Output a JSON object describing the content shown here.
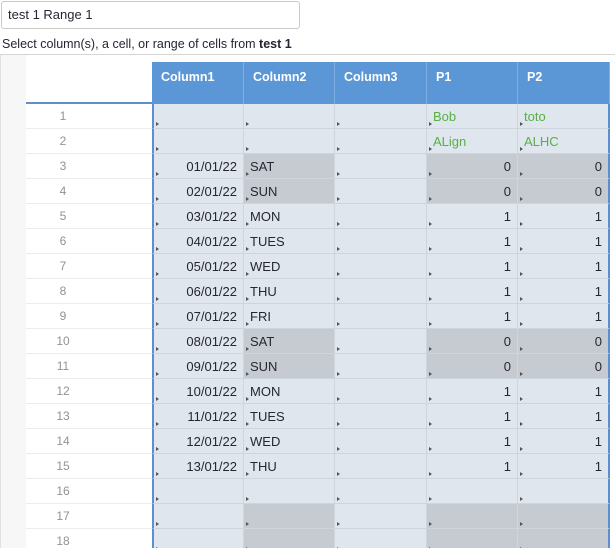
{
  "range_input": {
    "value": "test 1 Range 1"
  },
  "instruction": {
    "prefix": "Select column(s), a cell, or range of cells from ",
    "table_name": "test 1"
  },
  "columns": [
    "Column1",
    "Column2",
    "Column3",
    "P1",
    "P2"
  ],
  "rows": [
    {
      "n": "1",
      "c1": "",
      "c2": "",
      "c3": "",
      "p1": "Bob",
      "p2": "toto",
      "green": true,
      "dark": false
    },
    {
      "n": "2",
      "c1": "",
      "c2": "",
      "c3": "",
      "p1": "ALign",
      "p2": "ALHC",
      "green": true,
      "dark": false
    },
    {
      "n": "3",
      "c1": "01/01/22",
      "c2": "SAT",
      "c3": "",
      "p1": "0",
      "p2": "0",
      "green": false,
      "dark": true
    },
    {
      "n": "4",
      "c1": "02/01/22",
      "c2": "SUN",
      "c3": "",
      "p1": "0",
      "p2": "0",
      "green": false,
      "dark": true
    },
    {
      "n": "5",
      "c1": "03/01/22",
      "c2": "MON",
      "c3": "",
      "p1": "1",
      "p2": "1",
      "green": false,
      "dark": false
    },
    {
      "n": "6",
      "c1": "04/01/22",
      "c2": "TUES",
      "c3": "",
      "p1": "1",
      "p2": "1",
      "green": false,
      "dark": false
    },
    {
      "n": "7",
      "c1": "05/01/22",
      "c2": "WED",
      "c3": "",
      "p1": "1",
      "p2": "1",
      "green": false,
      "dark": false
    },
    {
      "n": "8",
      "c1": "06/01/22",
      "c2": "THU",
      "c3": "",
      "p1": "1",
      "p2": "1",
      "green": false,
      "dark": false
    },
    {
      "n": "9",
      "c1": "07/01/22",
      "c2": "FRI",
      "c3": "",
      "p1": "1",
      "p2": "1",
      "green": false,
      "dark": false
    },
    {
      "n": "10",
      "c1": "08/01/22",
      "c2": "SAT",
      "c3": "",
      "p1": "0",
      "p2": "0",
      "green": false,
      "dark": true
    },
    {
      "n": "11",
      "c1": "09/01/22",
      "c2": "SUN",
      "c3": "",
      "p1": "0",
      "p2": "0",
      "green": false,
      "dark": true
    },
    {
      "n": "12",
      "c1": "10/01/22",
      "c2": "MON",
      "c3": "",
      "p1": "1",
      "p2": "1",
      "green": false,
      "dark": false
    },
    {
      "n": "13",
      "c1": "11/01/22",
      "c2": "TUES",
      "c3": "",
      "p1": "1",
      "p2": "1",
      "green": false,
      "dark": false
    },
    {
      "n": "14",
      "c1": "12/01/22",
      "c2": "WED",
      "c3": "",
      "p1": "1",
      "p2": "1",
      "green": false,
      "dark": false
    },
    {
      "n": "15",
      "c1": "13/01/22",
      "c2": "THU",
      "c3": "",
      "p1": "1",
      "p2": "1",
      "green": false,
      "dark": false
    },
    {
      "n": "16",
      "c1": "",
      "c2": "",
      "c3": "",
      "p1": "",
      "p2": "",
      "green": false,
      "dark": false
    },
    {
      "n": "17",
      "c1": "",
      "c2": "",
      "c3": "",
      "p1": "",
      "p2": "",
      "green": false,
      "dark": true
    },
    {
      "n": "18",
      "c1": "",
      "c2": "",
      "c3": "",
      "p1": "",
      "p2": "",
      "green": false,
      "dark": true
    }
  ],
  "colors": {
    "header": "#5b96d6",
    "selection": "#dfe6ee",
    "weekend": "#c6cbd1",
    "text_green": "#57b046"
  }
}
